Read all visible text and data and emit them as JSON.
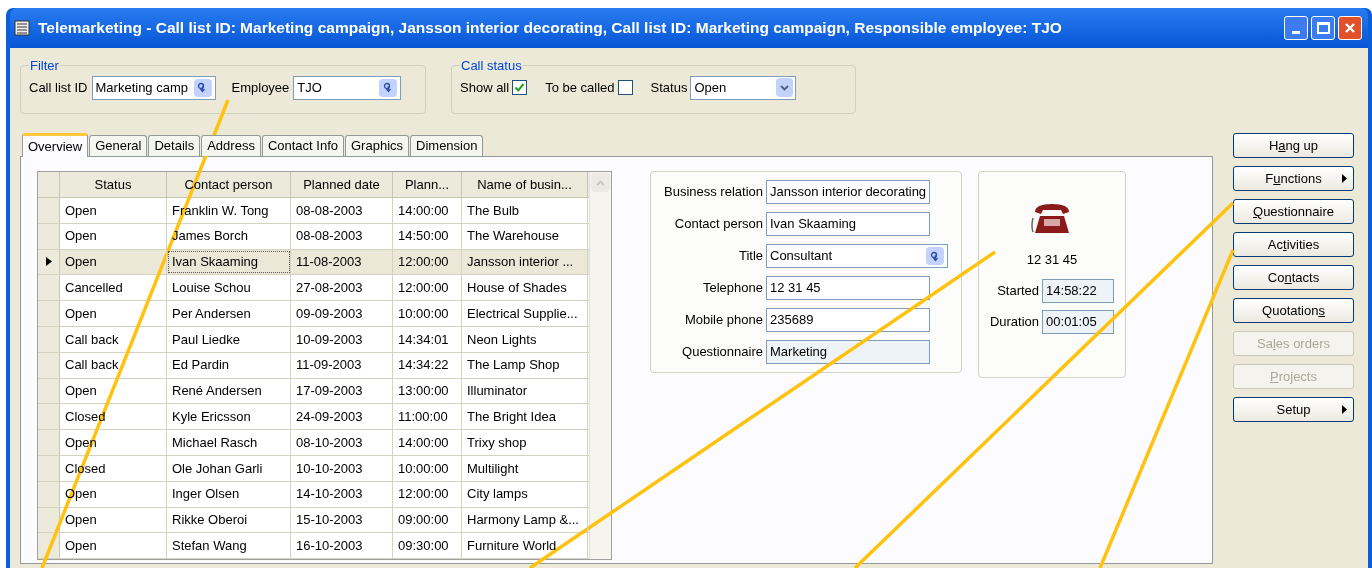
{
  "window": {
    "title": "Telemarketing - Call list ID: Marketing campaign, Jansson interior decorating, Call list ID: Marketing campaign, Responsible employee: TJO"
  },
  "filter": {
    "legend": "Filter",
    "call_list_label": "Call list ID",
    "call_list_value": "Marketing camp",
    "employee_label": "Employee",
    "employee_value": "TJO"
  },
  "call_status": {
    "legend": "Call status",
    "checks": [
      {
        "label": "Show all",
        "checked": true
      },
      {
        "label": "To be called",
        "checked": false
      }
    ],
    "status_label": "Status",
    "status_value": "Open"
  },
  "tabs": [
    {
      "label": "Overview",
      "selected": true
    },
    {
      "label": "General",
      "selected": false
    },
    {
      "label": "Details",
      "selected": false
    },
    {
      "label": "Address",
      "selected": false
    },
    {
      "label": "Contact Info",
      "selected": false
    },
    {
      "label": "Graphics",
      "selected": false
    },
    {
      "label": "Dimension",
      "selected": false
    }
  ],
  "table": {
    "columns": [
      "Status",
      "Contact person",
      "Planned date",
      "Plann...",
      "Name of busin..."
    ],
    "rows": [
      {
        "selected": false,
        "cells": [
          "Open",
          "Franklin W. Tong",
          "08-08-2003",
          "14:00:00",
          "The Bulb"
        ]
      },
      {
        "selected": false,
        "cells": [
          "Open",
          "James Borch",
          "08-08-2003",
          "14:50:00",
          "The Warehouse"
        ]
      },
      {
        "selected": true,
        "cells": [
          "Open",
          "Ivan Skaaming",
          "11-08-2003",
          "12:00:00",
          "Jansson interior ..."
        ]
      },
      {
        "selected": false,
        "cells": [
          "Cancelled",
          "Louise Schou",
          "27-08-2003",
          "12:00:00",
          "House of Shades"
        ]
      },
      {
        "selected": false,
        "cells": [
          "Open",
          "Per Andersen",
          "09-09-2003",
          "10:00:00",
          "Electrical Supplie..."
        ]
      },
      {
        "selected": false,
        "cells": [
          "Call back",
          "Paul Liedke",
          "10-09-2003",
          "14:34:01",
          "Neon Lights"
        ]
      },
      {
        "selected": false,
        "cells": [
          "Call back",
          "Ed Pardin",
          "11-09-2003",
          "14:34:22",
          "The Lamp Shop"
        ]
      },
      {
        "selected": false,
        "cells": [
          "Open",
          "René Andersen",
          "17-09-2003",
          "13:00:00",
          "Illuminator"
        ]
      },
      {
        "selected": false,
        "cells": [
          "Closed",
          "Kyle Ericsson",
          "24-09-2003",
          "11:00:00",
          "The Bright Idea"
        ]
      },
      {
        "selected": false,
        "cells": [
          "Open",
          "Michael Rasch",
          "08-10-2003",
          "14:00:00",
          "Trixy shop"
        ]
      },
      {
        "selected": false,
        "cells": [
          "Closed",
          "Ole Johan Garli",
          "10-10-2003",
          "10:00:00",
          "Multilight"
        ]
      },
      {
        "selected": false,
        "cells": [
          "Open",
          "Inger Olsen",
          "14-10-2003",
          "12:00:00",
          "City lamps"
        ]
      },
      {
        "selected": false,
        "cells": [
          "Open",
          "Rikke Oberoi",
          "15-10-2003",
          "09:00:00",
          "Harmony Lamp &..."
        ]
      },
      {
        "selected": false,
        "cells": [
          "Open",
          "Stefan Wang",
          "16-10-2003",
          "09:30:00",
          "Furniture World"
        ]
      }
    ]
  },
  "details": [
    {
      "label": "Business relation",
      "value": "Jansson interior decorating",
      "kind": "text"
    },
    {
      "label": "Contact person",
      "value": "Ivan Skaaming",
      "kind": "text"
    },
    {
      "label": "Title",
      "value": "Consultant",
      "kind": "lookup"
    },
    {
      "label": "Telephone",
      "value": "12 31 45",
      "kind": "text"
    },
    {
      "label": "Mobile phone",
      "value": "235689",
      "kind": "text"
    },
    {
      "label": "Questionnaire",
      "value": "Marketing",
      "kind": "readonly"
    }
  ],
  "call": {
    "number": "12 31 45",
    "fields": [
      {
        "label": "Started",
        "value": "14:58:22"
      },
      {
        "label": "Duration",
        "value": "00:01:05"
      }
    ]
  },
  "buttons": [
    {
      "before": "H",
      "key": "a",
      "after": "ng up",
      "disabled": false,
      "submenu": false
    },
    {
      "before": "F",
      "key": "u",
      "after": "nctions",
      "disabled": false,
      "submenu": true
    },
    {
      "key": "Q",
      "after": "uestionnaire",
      "disabled": false,
      "submenu": false
    },
    {
      "before": "Ac",
      "key": "t",
      "after": "ivities",
      "disabled": false,
      "submenu": false
    },
    {
      "before": "Co",
      "key": "n",
      "after": "tacts",
      "disabled": false,
      "submenu": false
    },
    {
      "before": "Quotation",
      "key": "s",
      "disabled": false,
      "submenu": false
    },
    {
      "before": "Sa",
      "key": "l",
      "after": "es orders",
      "disabled": true,
      "submenu": false
    },
    {
      "key": "P",
      "after": "rojects",
      "disabled": true,
      "submenu": false
    },
    {
      "before": "Setup",
      "disabled": false,
      "submenu": true
    }
  ]
}
